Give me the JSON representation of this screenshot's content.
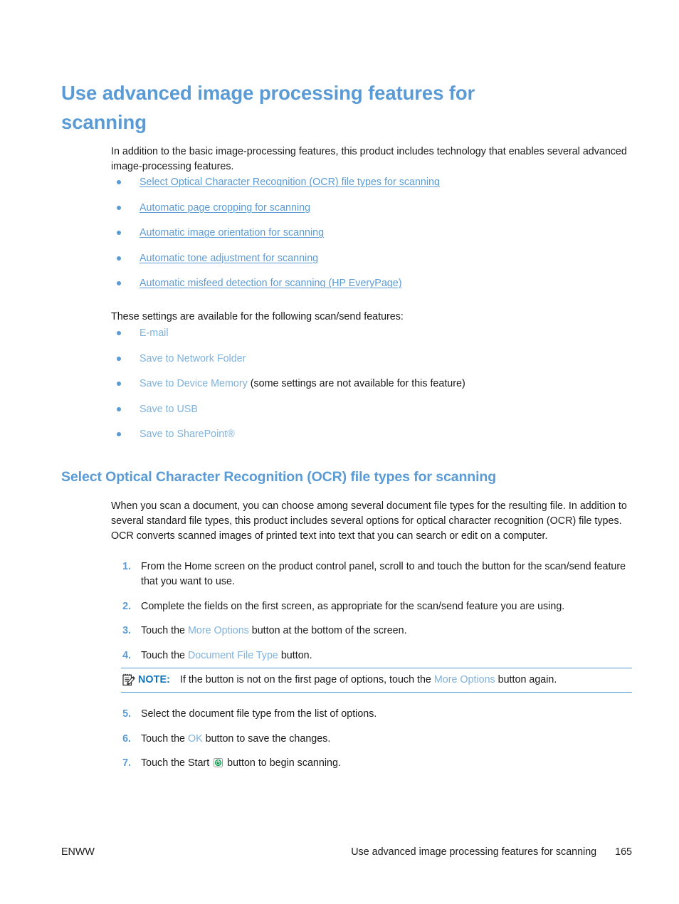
{
  "headings": {
    "h1": "Use advanced image processing features for scanning",
    "h2": "Select Optical Character Recognition (OCR) file types for scanning"
  },
  "paragraphs": {
    "intro": "In addition to the basic image-processing features, this product includes technology that enables several advanced image-processing features.",
    "lead_in": "These settings are available for the following scan/send features:",
    "ocr": "When you scan a document, you can choose among several document file types for the resulting file. In addition to several standard file types, this product includes several options for optical character recognition (OCR) file types. OCR converts scanned images of printed text into text that you can search or edit on a computer."
  },
  "link_list": [
    "Select Optical Character Recognition (OCR) file types for scanning",
    "Automatic page cropping for scanning",
    "Automatic image orientation for scanning",
    "Automatic tone adjustment for scanning",
    "Automatic misfeed detection for scanning (HP EveryPage)"
  ],
  "feature_list": [
    {
      "term": "E-mail",
      "suffix": ""
    },
    {
      "term": "Save to Network Folder",
      "suffix": ""
    },
    {
      "term": "Save to Device Memory",
      "suffix": " (some settings are not available for this feature)"
    },
    {
      "term": "Save to USB",
      "suffix": ""
    },
    {
      "term": "Save to SharePoint®",
      "suffix": ""
    }
  ],
  "steps_a": [
    {
      "num": "1.",
      "pre": "From the Home screen on the product control panel, scroll to and touch the button for the scan/send feature that you want to use.",
      "term": "",
      "post": ""
    },
    {
      "num": "2.",
      "pre": "Complete the fields on the first screen, as appropriate for the scan/send feature you are using.",
      "term": "",
      "post": ""
    },
    {
      "num": "3.",
      "pre": "Touch the ",
      "term": "More Options",
      "post": " button at the bottom of the screen."
    },
    {
      "num": "4.",
      "pre": "Touch the ",
      "term": "Document File Type",
      "post": " button."
    }
  ],
  "note": {
    "icon": "note-pencil-icon",
    "label": "NOTE:",
    "pre": "If the button is not on the first page of options, touch the ",
    "term": "More Options",
    "post": " button again."
  },
  "steps_b": [
    {
      "num": "5.",
      "pre": "Select the document file type from the list of options.",
      "term": "",
      "post": ""
    },
    {
      "num": "6.",
      "pre": "Touch the ",
      "term": "OK",
      "post": " button to save the changes."
    },
    {
      "num": "7.",
      "pre": "Touch the Start ",
      "term": "",
      "post": " button to begin scanning.",
      "icon": "start-button-icon"
    }
  ],
  "footer": {
    "left": "ENWW",
    "title": "Use advanced image processing features for scanning",
    "page": "165"
  },
  "colors": {
    "heading_blue": "#5b9bd5",
    "link_blue": "#5b9bd5",
    "ui_term_blue": "#7fb2dd",
    "note_label_blue": "#1273b8",
    "start_icon_green": "#00a14b",
    "body_text": "#1a1a1a"
  }
}
